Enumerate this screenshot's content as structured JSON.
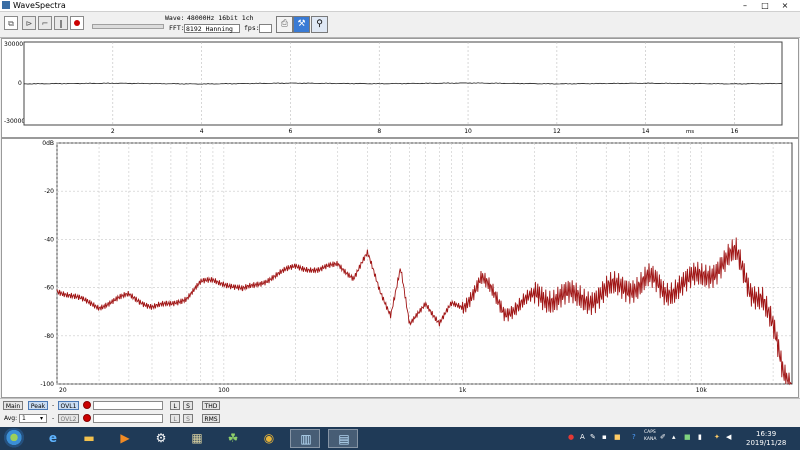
{
  "window": {
    "title": "WaveSpectra",
    "controls": {
      "minimize": "–",
      "maximize": "□",
      "close": "×"
    }
  },
  "toolbar": {
    "wave_label": "Wave:",
    "wave_value": "48000Hz 16bit 1ch",
    "fft_label": "FFT:",
    "fft_value": "8192 Hanning",
    "fps_label": "fps:",
    "icons": [
      "copy-icon",
      "play-icon",
      "stop-icon",
      "pause-icon",
      "record-icon",
      "export-icon",
      "settings-icon",
      "search-icon"
    ]
  },
  "waveform": {
    "y_ticks": [
      "30000",
      "0",
      "-30000"
    ],
    "x_ticks": [
      "2",
      "4",
      "6",
      "8",
      "10",
      "12",
      "14",
      "16"
    ],
    "x_unit": "ms"
  },
  "spectrum": {
    "y_ticks": [
      "0dB",
      "-20",
      "-40",
      "-60",
      "-80",
      "-100"
    ],
    "x_ticks": [
      "20",
      "100",
      "1k",
      "10k"
    ]
  },
  "bottom_bar": {
    "main_label": "Main",
    "peak_label": "Peak",
    "dash1": "-",
    "ovl1_label": "OVL1",
    "l_label": "L",
    "s_label": "S",
    "thd_label": "THD",
    "avg_label": "Avg:",
    "avg_value": "1",
    "dash2": "-",
    "ovl2_label": "OVL2",
    "l2_label": "L",
    "s2_label": "S",
    "rms_label": "RMS"
  },
  "taskbar": {
    "apps": [
      "ie-icon",
      "explorer-icon",
      "media-player-icon",
      "network-icon",
      "photo-icon",
      "people-icon",
      "chrome-icon",
      "spectrum-app-icon",
      "wavespectra-icon"
    ],
    "tray_caps": "CAPS",
    "tray_kana": "KANA",
    "time": "16:39",
    "date": "2019/11/28"
  },
  "chart_data": [
    {
      "type": "line",
      "title": "",
      "xlabel": "ms",
      "ylabel": "",
      "xlim": [
        0,
        17.07
      ],
      "ylim": [
        -32768,
        32767
      ],
      "grid": true,
      "series": [
        {
          "x": [
            0,
            2,
            4,
            6,
            8,
            10,
            12,
            14,
            16,
            17
          ],
          "values": [
            -300,
            200,
            -400,
            300,
            -200,
            400,
            -300,
            200,
            -300,
            0
          ]
        }
      ]
    },
    {
      "type": "line",
      "title": "",
      "xlabel": "",
      "ylabel": "dB",
      "xscale": "log",
      "xlim": [
        20,
        24000
      ],
      "ylim": [
        -100,
        0
      ],
      "grid": true,
      "color": "#a01515",
      "series": [
        {
          "x": [
            20,
            30,
            40,
            50,
            60,
            70,
            80,
            90,
            100,
            120,
            150,
            200,
            250,
            300,
            350,
            400,
            450,
            500,
            550,
            600,
            700,
            800,
            900,
            1000,
            1200,
            1500,
            2000,
            2500,
            3000,
            4000,
            5000,
            6000,
            7000,
            8000,
            9000,
            10000,
            12000,
            14000,
            16000,
            18000,
            20000,
            22000,
            24000
          ],
          "values": [
            -61,
            -68,
            -63,
            -68,
            -67,
            -64,
            -58,
            -57,
            -58,
            -61,
            -57,
            -51,
            -53,
            -50,
            -56,
            -46,
            -61,
            -71,
            -52,
            -76,
            -66,
            -75,
            -67,
            -68,
            -56,
            -70,
            -64,
            -63,
            -65,
            -62,
            -59,
            -57,
            -62,
            -58,
            -58,
            -56,
            -50,
            -47,
            -60,
            -63,
            -78,
            -96,
            -100
          ]
        }
      ]
    }
  ]
}
